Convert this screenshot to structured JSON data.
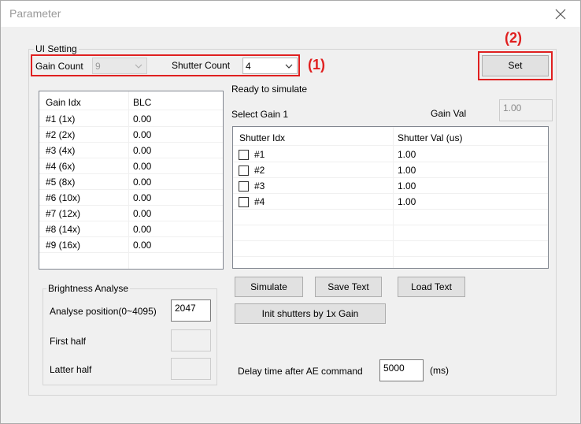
{
  "window": {
    "title": "Parameter"
  },
  "ui_setting": {
    "group_label": "UI Setting",
    "gain_count_label": "Gain Count",
    "gain_count_value": "9",
    "shutter_count_label": "Shutter Count",
    "shutter_count_value": "4",
    "set_label": "Set"
  },
  "annotations": {
    "a1": "(1)",
    "a2": "(2)"
  },
  "status": "Ready to simulate",
  "gain_select": {
    "select_label": "Select Gain 1",
    "gain_val_label": "Gain Val",
    "gain_val_value": "1.00"
  },
  "gain_table": {
    "headers": [
      "Gain Idx",
      "BLC"
    ],
    "rows": [
      [
        "#1 (1x)",
        "0.00"
      ],
      [
        "#2 (2x)",
        "0.00"
      ],
      [
        "#3 (4x)",
        "0.00"
      ],
      [
        "#4 (6x)",
        "0.00"
      ],
      [
        "#5 (8x)",
        "0.00"
      ],
      [
        "#6 (10x)",
        "0.00"
      ],
      [
        "#7 (12x)",
        "0.00"
      ],
      [
        "#8 (14x)",
        "0.00"
      ],
      [
        "#9 (16x)",
        "0.00"
      ]
    ]
  },
  "shutter_table": {
    "headers": [
      "Shutter Idx",
      "Shutter Val (us)"
    ],
    "rows": [
      [
        "#1",
        "1.00"
      ],
      [
        "#2",
        "1.00"
      ],
      [
        "#3",
        "1.00"
      ],
      [
        "#4",
        "1.00"
      ]
    ]
  },
  "buttons": {
    "simulate": "Simulate",
    "save_text": "Save Text",
    "load_text": "Load Text",
    "init_shutters": "Init shutters by 1x Gain"
  },
  "brightness": {
    "group_label": "Brightness Analyse",
    "analyse_position_label": "Analyse position(0~4095)",
    "analyse_position_value": "2047",
    "first_half_label": "First half",
    "latter_half_label": "Latter half"
  },
  "delay": {
    "label": "Delay time after AE command",
    "value": "5000",
    "unit": "(ms)"
  },
  "colors": {
    "annotation_red": "#e02020"
  },
  "icons": {
    "close": "close-icon",
    "dropdown": "chevron-down-icon"
  }
}
